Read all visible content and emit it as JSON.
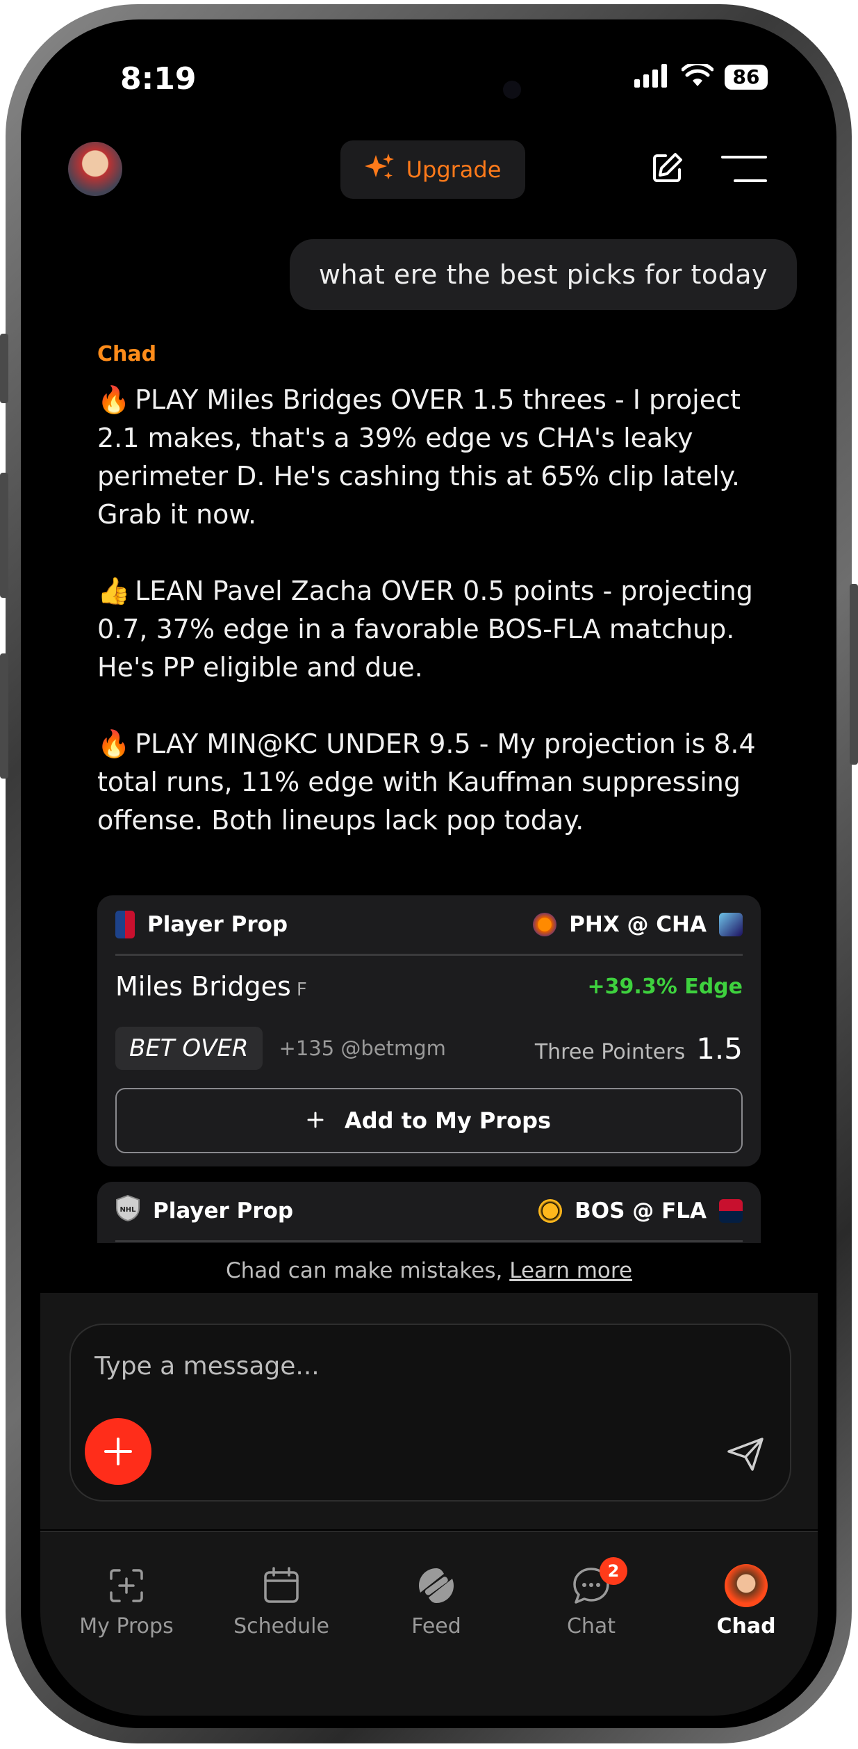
{
  "status": {
    "time": "8:19",
    "battery": "86"
  },
  "header": {
    "upgrade_label": "Upgrade"
  },
  "user_message": "what ere the best picks for today",
  "bot": {
    "name": "Chad",
    "paragraphs": [
      {
        "emoji": "🔥",
        "text": "PLAY Miles Bridges OVER 1.5 threes - I project 2.1 makes, that's a 39% edge vs CHA's leaky perimeter D. He's cashing this at 65% clip lately. Grab it now."
      },
      {
        "emoji": "👍",
        "text": "LEAN Pavel Zacha OVER 0.5 points - projecting 0.7, 37% edge in a favorable BOS-FLA matchup. He's PP eligible and due."
      },
      {
        "emoji": "🔥",
        "text": "PLAY MIN@KC UNDER 9.5 - My projection is 8.4 total runs, 11% edge with Kauffman suppressing offense. Both lineups lack pop today."
      }
    ]
  },
  "cards": [
    {
      "type_label": "Player Prop",
      "matchup": "PHX @ CHA",
      "player": "Miles Bridges",
      "position": "F",
      "edge": "+39.3% Edge",
      "bet": "BET OVER",
      "odds": "+135 @betmgm",
      "stat_label": "Three Pointers",
      "stat_value": "1.5",
      "add_label": "Add to My Props"
    },
    {
      "type_label": "Player Prop",
      "matchup": "BOS @ FLA"
    }
  ],
  "disclaimer": {
    "text": "Chad can make mistakes,",
    "link": "Learn more"
  },
  "composer": {
    "placeholder": "Type a message..."
  },
  "tabs": [
    {
      "label": "My Props"
    },
    {
      "label": "Schedule"
    },
    {
      "label": "Feed"
    },
    {
      "label": "Chat",
      "badge": "2"
    },
    {
      "label": "Chad"
    }
  ],
  "colors": {
    "accent": "#ff7a1a",
    "edge": "#3ed13e",
    "plus": "#ff2d1a"
  }
}
